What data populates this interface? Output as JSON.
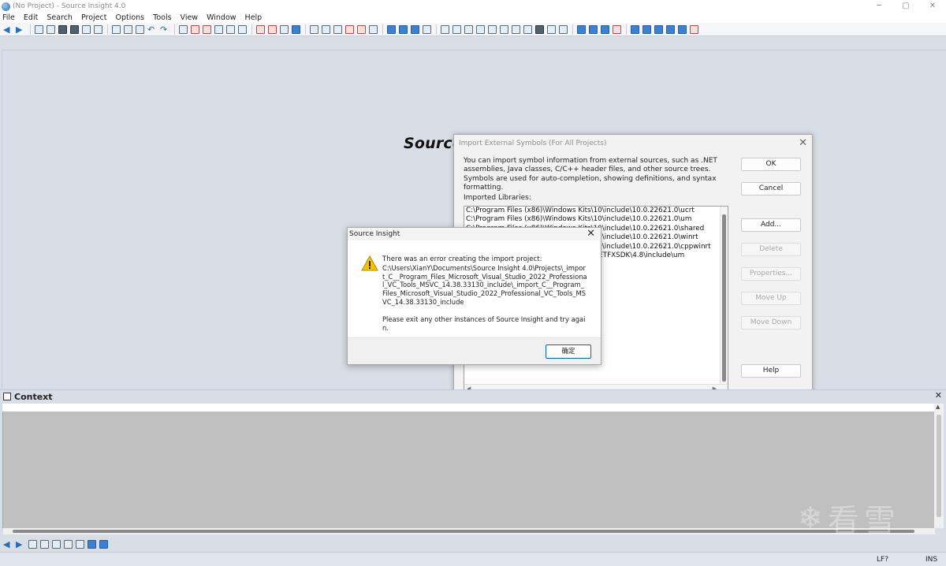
{
  "window": {
    "title": "(No Project) - Source Insight 4.0",
    "controls": [
      "─",
      "▢",
      "✕"
    ]
  },
  "menu": [
    "File",
    "Edit",
    "Search",
    "Project",
    "Options",
    "Tools",
    "View",
    "Window",
    "Help"
  ],
  "main": {
    "banner": "Source"
  },
  "import_dialog": {
    "title": "Import External Symbols (For All Projects)",
    "close": "✕",
    "description": "You can import symbol information from external sources, such as .NET assemblies, Java classes, C/C++ header files, and other source trees. Symbols are used for auto-completion, showing definitions, and syntax formatting.",
    "libraries_label": "Imported Libraries:",
    "libraries": [
      "C:\\Program Files (x86)\\Windows Kits\\10\\include\\10.0.22621.0\\ucrt",
      "C:\\Program Files (x86)\\Windows Kits\\10\\include\\10.0.22621.0\\um",
      "C:\\Program Files (x86)\\Windows Kits\\10\\include\\10.0.22621.0\\shared",
      "C:\\Program Files (x86)\\Windows Kits\\10\\include\\10.0.22621.0\\winrt",
      "C:\\Program Files (x86)\\Windows Kits\\10\\include\\10.0.22621.0\\cppwinrt",
      "C:\\Program Files (x86)\\Windows Kits\\NETFXSDK\\4.8\\include\\um"
    ],
    "buttons": {
      "ok": "OK",
      "cancel": "Cancel",
      "add": "Add...",
      "delete": "Delete",
      "properties": "Properties...",
      "move_up": "Move Up",
      "move_down": "Move Down",
      "help": "Help"
    }
  },
  "error_dialog": {
    "title": "Source Insight",
    "close": "✕",
    "message_first": "There was an error creating the import project:",
    "message_path": "C:\\Users\\XianY\\Documents\\Source Insight 4.0\\Projects\\_import_C__Program_Files_Microsoft_Visual_Studio_2022_Professional_VC_Tools_MSVC_14.38.33130_include\\_import_C__Program_Files_Microsoft_Visual_Studio_2022_Professional_VC_Tools_MSVC_14.38.33130_include",
    "message_retry": "Please exit any other instances of Source Insight and try again.",
    "ok_button": "确定"
  },
  "context_panel": {
    "title": "Context",
    "close": "✕"
  },
  "statusbar": {
    "line_ending": "LF?",
    "mode": "INS"
  },
  "watermark": {
    "text": "看雪"
  }
}
